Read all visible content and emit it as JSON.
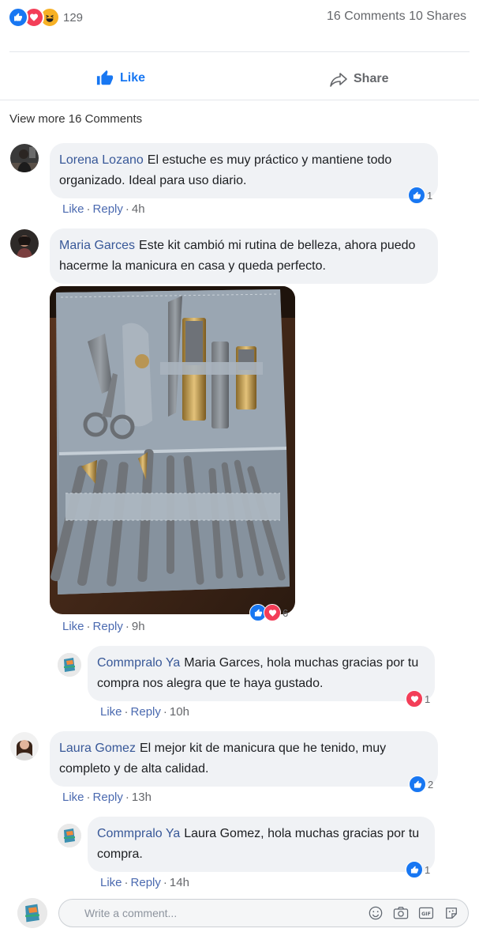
{
  "post": {
    "reaction_count": "129",
    "comments_count": "16 Comments",
    "shares_count": "10 Shares",
    "like_label": "Like",
    "share_label": "Share"
  },
  "view_more": "View more 16 Comments",
  "comments": [
    {
      "name": "Lorena Lozano",
      "text": "El estuche es muy práctico y mantiene todo organizado. Ideal para uso diario.",
      "like": "Like",
      "reply": "Reply",
      "time": "4h",
      "reaction_count": "1",
      "reactions": [
        "like"
      ]
    },
    {
      "name": "Maria Garces",
      "text": "Este kit cambió mi rutina de belleza, ahora puedo hacerme la manicura en casa y queda perfecto.",
      "like": "Like",
      "reply": "Reply",
      "time": "9h",
      "reaction_count": "6",
      "reactions": [
        "like",
        "love"
      ],
      "has_photo": true
    }
  ],
  "replies": [
    {
      "name": "Commpralo Ya",
      "text": "Maria Garces, hola muchas gracias por tu compra nos alegra que te haya gustado.",
      "like": "Like",
      "reply": "Reply",
      "time": "10h",
      "reaction_count": "1",
      "reactions": [
        "love"
      ]
    }
  ],
  "comment3": {
    "name": "Laura Gomez",
    "text": "El mejor kit de manicura que he tenido, muy completo y de alta calidad.",
    "like": "Like",
    "reply": "Reply",
    "time": "13h",
    "reaction_count": "2",
    "reactions": [
      "like"
    ]
  },
  "reply2": {
    "name": "Commpralo Ya",
    "text": "Laura Gomez, hola muchas gracias por tu compra.",
    "like": "Like",
    "reply": "Reply",
    "time": "14h",
    "reaction_count": "1",
    "reactions": [
      "like"
    ]
  },
  "composer": {
    "placeholder": "Write a comment..."
  },
  "colors": {
    "accent": "#1877f2",
    "love": "#f33e58",
    "name_link": "#385898",
    "bubble_bg": "#f0f2f5"
  }
}
